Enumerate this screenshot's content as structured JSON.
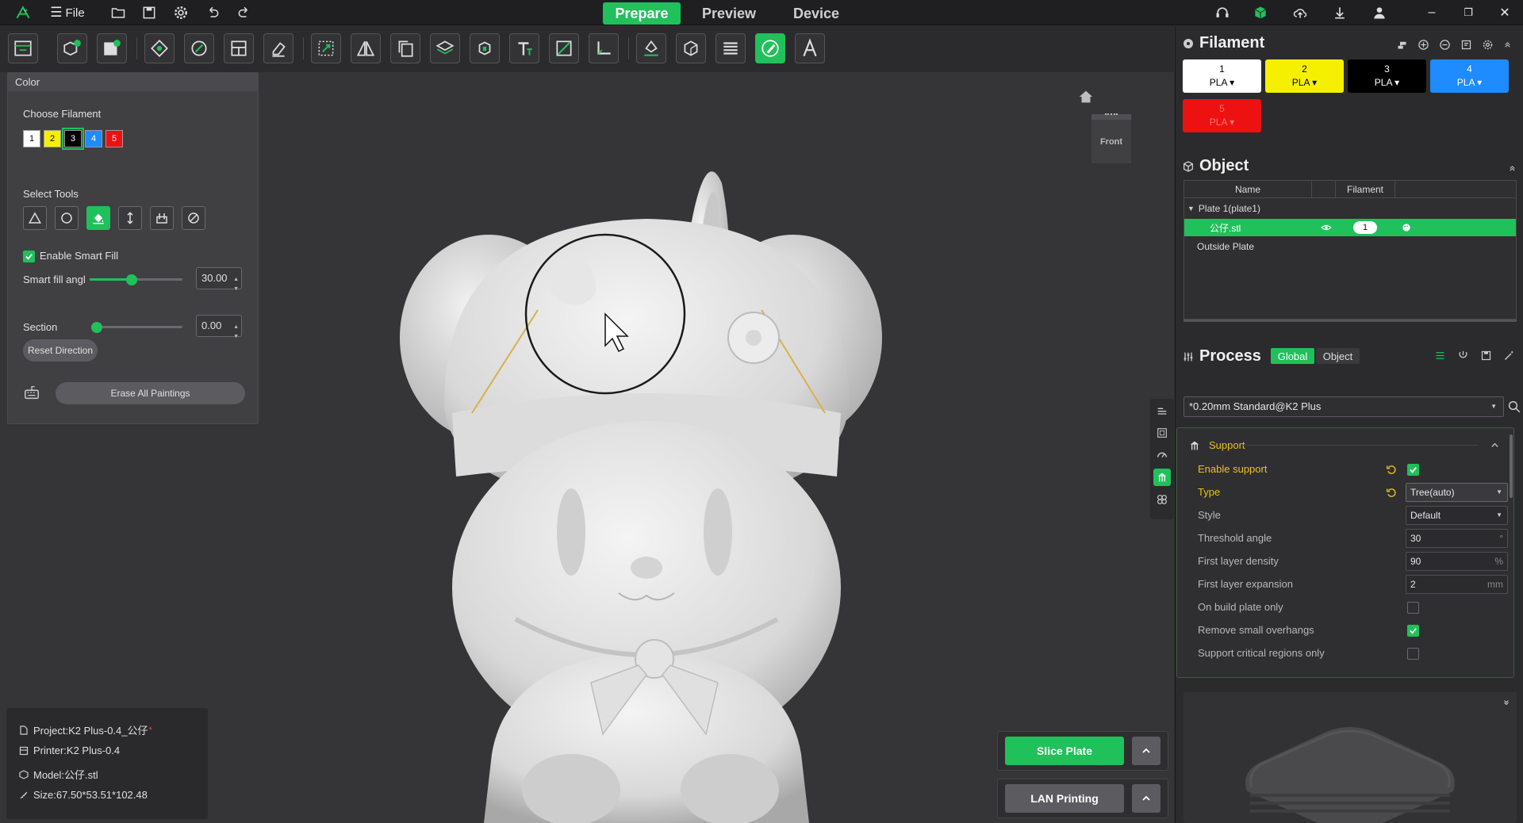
{
  "app": {
    "file_label": "File"
  },
  "tabs": [
    {
      "label": "Prepare",
      "active": true
    },
    {
      "label": "Preview",
      "active": false
    },
    {
      "label": "Device",
      "active": false
    }
  ],
  "color_panel": {
    "title": "Color",
    "choose_filament_label": "Choose Filament",
    "filaments": [
      {
        "num": "1",
        "color": "#ffffff",
        "text_color": "#000000"
      },
      {
        "num": "2",
        "color": "#f5f000",
        "text_color": "#000000"
      },
      {
        "num": "3",
        "color": "#000000",
        "text_color": "#ffffff",
        "selected": true
      },
      {
        "num": "4",
        "color": "#1e8bff",
        "text_color": "#ffffff"
      },
      {
        "num": "5",
        "color": "#ee1111",
        "text_color": "#ffffff"
      }
    ],
    "select_tools_label": "Select Tools",
    "enable_smart_fill_label": "Enable Smart Fill",
    "enable_smart_fill_checked": true,
    "smart_fill_label": "Smart fill angl",
    "smart_fill_value": "30.00",
    "smart_fill_level": 0.45,
    "section_label": "Section",
    "section_value": "0.00",
    "section_level": 0,
    "reset_direction_label": "Reset Direction",
    "erase_label": "Erase All Paintings"
  },
  "view_cube": {
    "label": "Front"
  },
  "info": {
    "project": "Project:K2 Plus-0.4_公仔",
    "modified_mark": "*",
    "printer": "Printer:K2 Plus-0.4",
    "model": "Model:公仔.stl",
    "size": "Size:67.50*53.51*102.48"
  },
  "actions": {
    "slice_label": "Slice Plate",
    "lan_label": "LAN Printing"
  },
  "filament_panel": {
    "title": "Filament",
    "chips": [
      {
        "num": "1",
        "type": "PLA",
        "color": "#ffffff",
        "text_color": "#000000"
      },
      {
        "num": "2",
        "type": "PLA",
        "color": "#f5f000",
        "text_color": "#000000"
      },
      {
        "num": "3",
        "type": "PLA",
        "color": "#000000",
        "text_color": "#ffffff"
      },
      {
        "num": "4",
        "type": "PLA",
        "color": "#1e8bff",
        "text_color": "#ffffff"
      },
      {
        "num": "5",
        "type": "PLA",
        "color": "#ee1111",
        "text_color": "#ee7777"
      }
    ]
  },
  "object_panel": {
    "title": "Object",
    "col_name": "Name",
    "col_filament": "Filament",
    "plate": "Plate 1(plate1)",
    "object_name": "公仔.stl",
    "object_filament": "1",
    "outside": "Outside Plate"
  },
  "process_panel": {
    "title": "Process",
    "seg_global": "Global",
    "seg_object": "Object",
    "preset": "*0.20mm Standard@K2 Plus",
    "section_title": "Support",
    "params": [
      {
        "label": "Enable support",
        "changed": true,
        "kind": "check",
        "checked": true
      },
      {
        "label": "Type",
        "changed": true,
        "kind": "select",
        "value": "Tree(auto)"
      },
      {
        "label": "Style",
        "changed": false,
        "kind": "select",
        "value": "Default"
      },
      {
        "label": "Threshold angle",
        "changed": false,
        "kind": "input",
        "value": "30",
        "unit": "°"
      },
      {
        "label": "First layer density",
        "changed": false,
        "kind": "input",
        "value": "90",
        "unit": "%"
      },
      {
        "label": "First layer expansion",
        "changed": false,
        "kind": "input",
        "value": "2",
        "unit": "mm"
      },
      {
        "label": "On build plate only",
        "changed": false,
        "kind": "check",
        "checked": false
      },
      {
        "label": "Remove small overhangs",
        "changed": false,
        "kind": "check",
        "checked": true
      },
      {
        "label": "Support critical regions only",
        "changed": false,
        "kind": "check",
        "checked": false
      }
    ]
  },
  "colors": {
    "accent": "#20c05a",
    "changed": "#e8c020"
  }
}
